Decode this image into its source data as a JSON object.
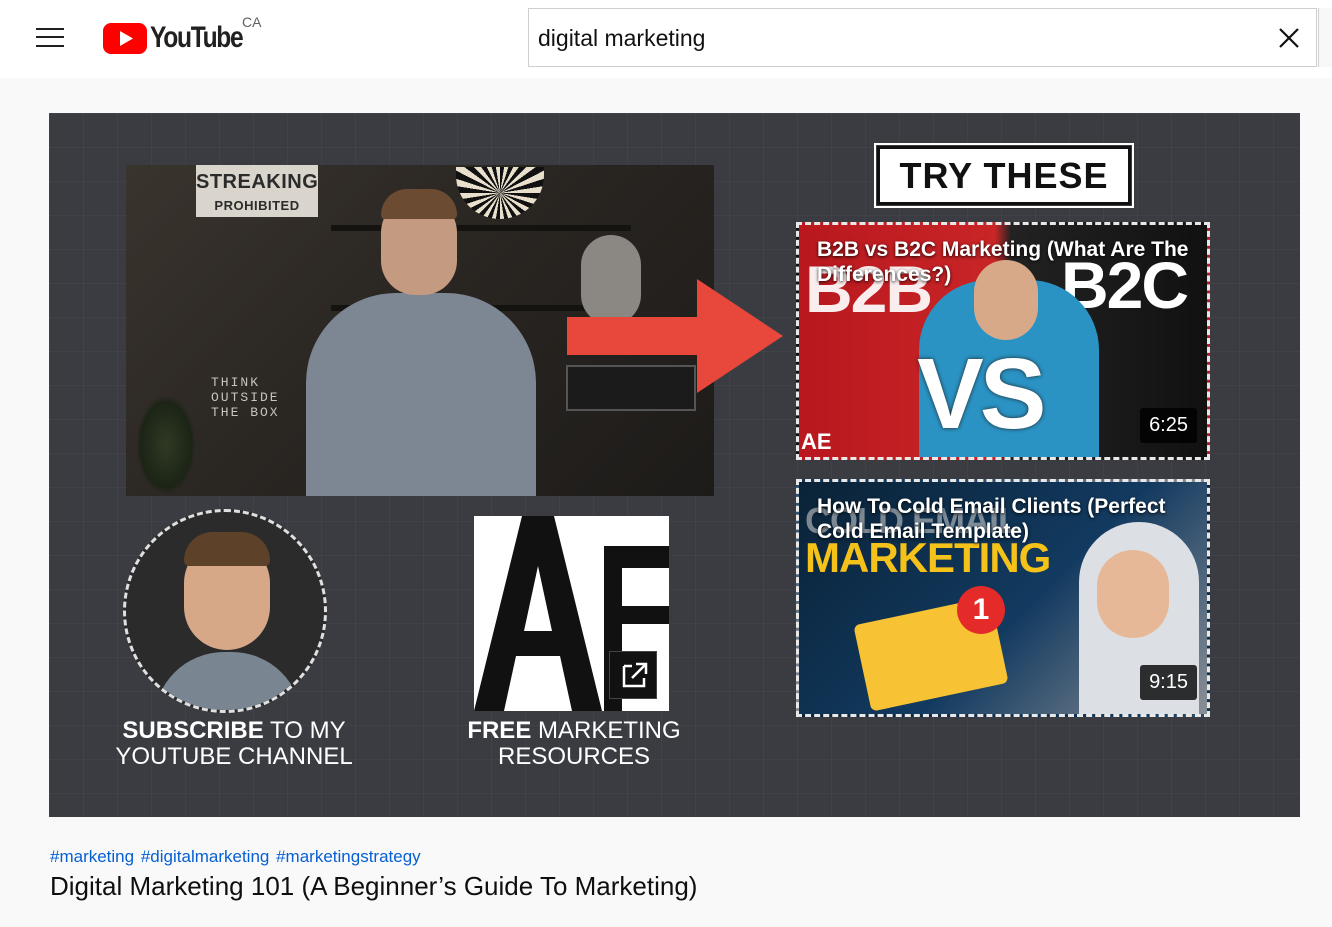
{
  "header": {
    "logo_text": "YouTube",
    "country": "CA",
    "search_value": "digital marketing"
  },
  "player": {
    "main_video_sign": [
      "STREAKING",
      "PROHIBITED"
    ],
    "main_video_poster": [
      "THINK",
      "OUTSIDE",
      "THE BOX"
    ],
    "try_these_label": "TRY THESE",
    "end_cards": [
      {
        "title": "B2B vs B2C Marketing (What Are The Differences?)",
        "duration": "6:25",
        "thumb_words": [
          "B2B",
          "B2C",
          "VS",
          "AE"
        ]
      },
      {
        "title": "How To Cold Email Clients (Perfect Cold Email Template)",
        "duration": "9:15",
        "thumb_words": [
          "COLD EMAIL",
          "MARKETING",
          "1"
        ]
      }
    ],
    "subscribe": {
      "bold": "SUBSCRIBE",
      "rest_line1": "TO MY",
      "line2": "YOUTUBE CHANNEL"
    },
    "resources": {
      "bold": "FREE",
      "rest_line1": "MARKETING",
      "line2": "RESOURCES"
    }
  },
  "video": {
    "hashtags": [
      "#marketing",
      "#digitalmarketing",
      "#marketingstrategy"
    ],
    "title": "Digital Marketing 101 (A Beginner’s Guide To Marketing)"
  },
  "colors": {
    "youtube_red": "#ff0000",
    "link_blue": "#065fd4",
    "arrow_red": "#e8473c"
  }
}
